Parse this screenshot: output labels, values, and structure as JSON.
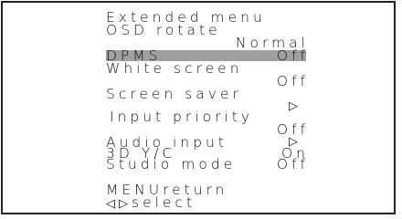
{
  "menu": {
    "title": "Extended menu",
    "osd_rotate": {
      "label": "OSD rotate",
      "value": "Normal"
    },
    "dpms": {
      "label": "DPMS",
      "value": "Off",
      "selected": true
    },
    "white_screen": {
      "label": "White screen",
      "value": "Off"
    },
    "screen_saver": {
      "label": "Screen saver",
      "arrow": "▷"
    },
    "input_priority": {
      "label": "Input priority",
      "value": "Off"
    },
    "audio_input": {
      "label": "Audio input",
      "arrow": "▷"
    },
    "y_c_3d": {
      "label": "3D Y/C",
      "value": "On"
    },
    "studio_mode": {
      "label": "Studio mode",
      "value": "Off"
    },
    "footer": {
      "menu_return": "MENUreturn",
      "select_arrows": "◁▷",
      "select": "select"
    },
    "highlight_color": "#a0a0a0"
  }
}
